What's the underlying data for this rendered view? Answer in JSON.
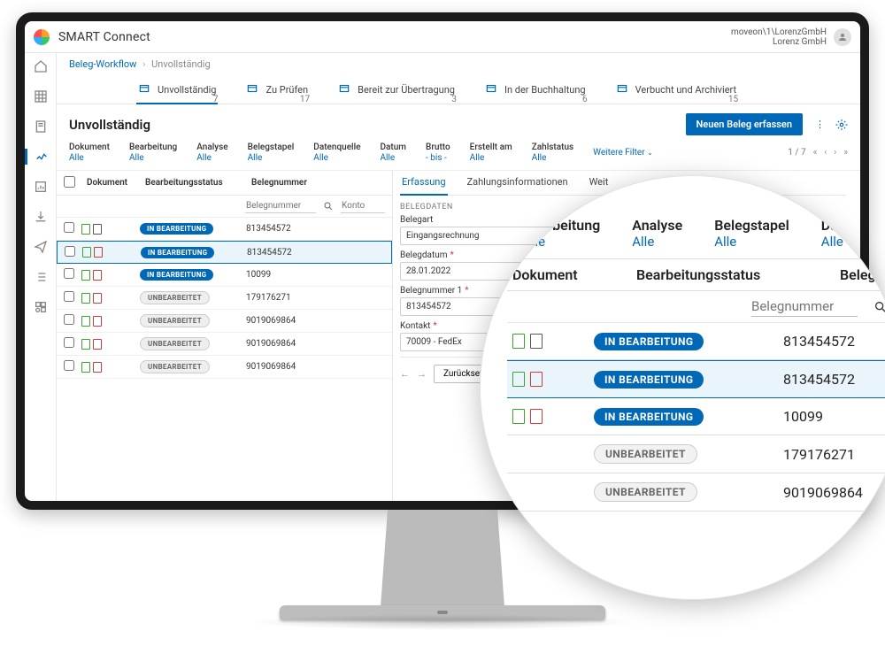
{
  "header": {
    "app_title": "SMART Connect",
    "user_path": "moveon\\1\\LorenzGmbH",
    "user_company": "Lorenz GmbH"
  },
  "breadcrumb": {
    "root": "Beleg-Workflow",
    "current": "Unvollständig"
  },
  "workflow_tabs": [
    {
      "label": "Unvollständig",
      "count": "7",
      "active": true
    },
    {
      "label": "Zu Prüfen",
      "count": "17"
    },
    {
      "label": "Bereit zur Übertragung",
      "count": "3"
    },
    {
      "label": "In der Buchhaltung",
      "count": "6"
    },
    {
      "label": "Verbucht und Archiviert",
      "count": "15"
    }
  ],
  "page": {
    "title": "Unvollständig",
    "primary_button": "Neuen Beleg erfassen"
  },
  "filters": [
    {
      "label": "Dokument",
      "value": "Alle"
    },
    {
      "label": "Bearbeitung",
      "value": "Alle"
    },
    {
      "label": "Analyse",
      "value": "Alle"
    },
    {
      "label": "Belegstapel",
      "value": "Alle"
    },
    {
      "label": "Datenquelle",
      "value": "Alle"
    },
    {
      "label": "Datum",
      "value": "Alle"
    },
    {
      "label": "Brutto",
      "value": "- bis -"
    },
    {
      "label": "Erstellt am",
      "value": "Alle"
    },
    {
      "label": "Zahlstatus",
      "value": "Alle"
    }
  ],
  "more_filters": "Weitere Filter",
  "pager": "1 / 7",
  "table": {
    "cols": {
      "c1": "Dokument",
      "c2": "Bearbeitungsstatus",
      "c3": "Belegnummer"
    },
    "filter_placeholder": "Belegnummer",
    "filter_placeholder2": "Konto",
    "rows": [
      {
        "status": "IN BEARBEITUNG",
        "status_kind": "blue",
        "ic1": "green",
        "ic2": "dark",
        "num": "813454572",
        "sel": false
      },
      {
        "status": "IN BEARBEITUNG",
        "status_kind": "blue",
        "ic1": "green",
        "ic2": "red",
        "num": "813454572",
        "sel": true
      },
      {
        "status": "IN BEARBEITUNG",
        "status_kind": "blue",
        "ic1": "green",
        "ic2": "red",
        "num": "10099",
        "sel": false
      },
      {
        "status": "UNBEARBEITET",
        "status_kind": "gray",
        "ic1": "green",
        "ic2": "red",
        "num": "179176271",
        "sel": false
      },
      {
        "status": "UNBEARBEITET",
        "status_kind": "gray",
        "ic1": "green",
        "ic2": "red",
        "num": "9019069864",
        "sel": false
      },
      {
        "status": "UNBEARBEITET",
        "status_kind": "gray",
        "ic1": "green",
        "ic2": "red",
        "num": "9019069864",
        "sel": false
      },
      {
        "status": "UNBEARBEITET",
        "status_kind": "gray",
        "ic1": "green",
        "ic2": "red",
        "num": "9019069864",
        "sel": false
      }
    ]
  },
  "detail": {
    "tabs": [
      "Erfassung",
      "Zahlungsinformationen",
      "Weit"
    ],
    "section": "BELEGDATEN",
    "fields": {
      "belegart_label": "Belegart",
      "belegart_value": "Eingangsrechnung",
      "belegdatum_label": "Belegdatum",
      "belegdatum_value": "28.01.2022",
      "belegnummer_label": "Belegnummer 1",
      "belegnummer_value": "813454572",
      "kontakt_label": "Kontakt",
      "kontakt_value": "70009 - FedEx"
    },
    "reset": "Zurücksetzen"
  },
  "zoom": {
    "cols": [
      {
        "h": "Bearbeitung",
        "v": "Alle"
      },
      {
        "h": "Analyse",
        "v": "Alle"
      },
      {
        "h": "Belegstapel",
        "v": "Alle"
      },
      {
        "h": "Datenq",
        "v": "Alle"
      }
    ],
    "hdr": {
      "a": "Dokument",
      "b": "Bearbeitungsstatus",
      "c": "Belegnummer"
    },
    "filter_ph": "Belegnummer",
    "filter_ph2": "Kon",
    "rows": [
      {
        "ic1": "green",
        "ic2": "dark",
        "status": "IN BEARBEITUNG",
        "kind": "blue",
        "num": "813454572",
        "sel": false
      },
      {
        "ic1": "green",
        "ic2": "red",
        "status": "IN BEARBEITUNG",
        "kind": "blue",
        "num": "813454572",
        "sel": true
      },
      {
        "ic1": "green",
        "ic2": "red",
        "status": "IN BEARBEITUNG",
        "kind": "blue",
        "num": "10099",
        "sel": false
      },
      {
        "ic1": "",
        "ic2": "",
        "status": "UNBEARBEITET",
        "kind": "gray",
        "num": "179176271",
        "sel": false
      },
      {
        "ic1": "",
        "ic2": "",
        "status": "UNBEARBEITET",
        "kind": "gray",
        "num": "9019069864",
        "sel": false
      }
    ]
  }
}
